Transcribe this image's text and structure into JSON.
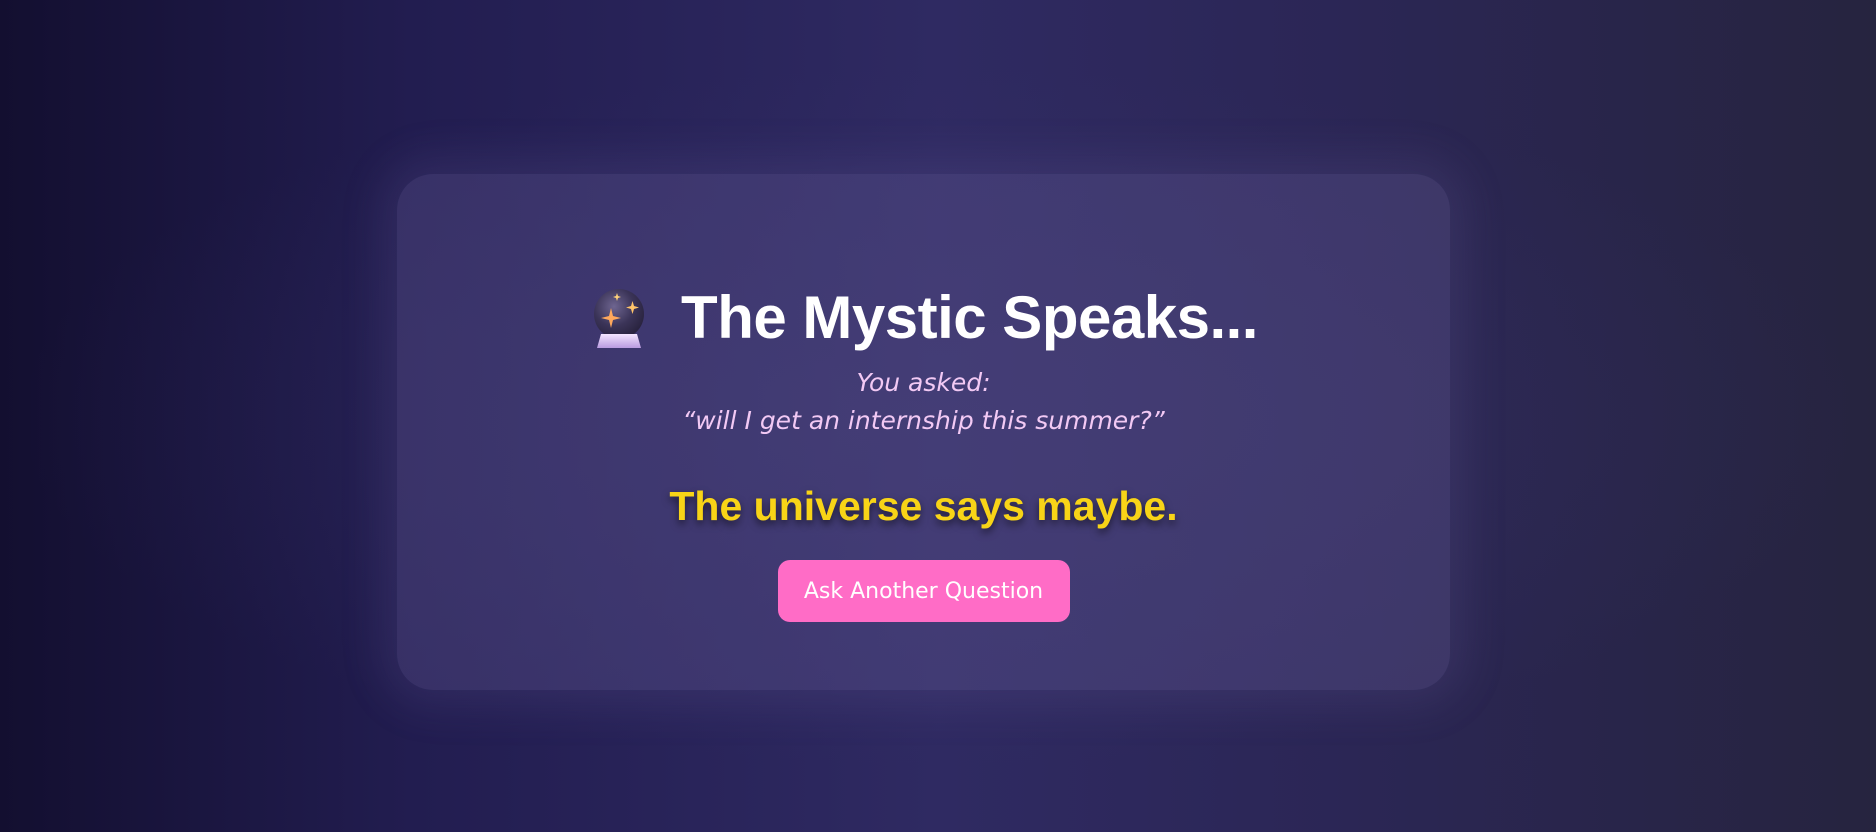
{
  "header": {
    "title": "The Mystic Speaks...",
    "icon": "crystal-ball-icon"
  },
  "question": {
    "prefix": "You asked:",
    "text": "“will I get an internship this summer?”"
  },
  "answer": {
    "text": "The universe says maybe."
  },
  "actions": {
    "ask_again_label": "Ask Another Question"
  },
  "colors": {
    "title": "#ffffff",
    "question": "#f2c9f4",
    "answer": "#f8d417",
    "button": "#ff6cc6"
  }
}
